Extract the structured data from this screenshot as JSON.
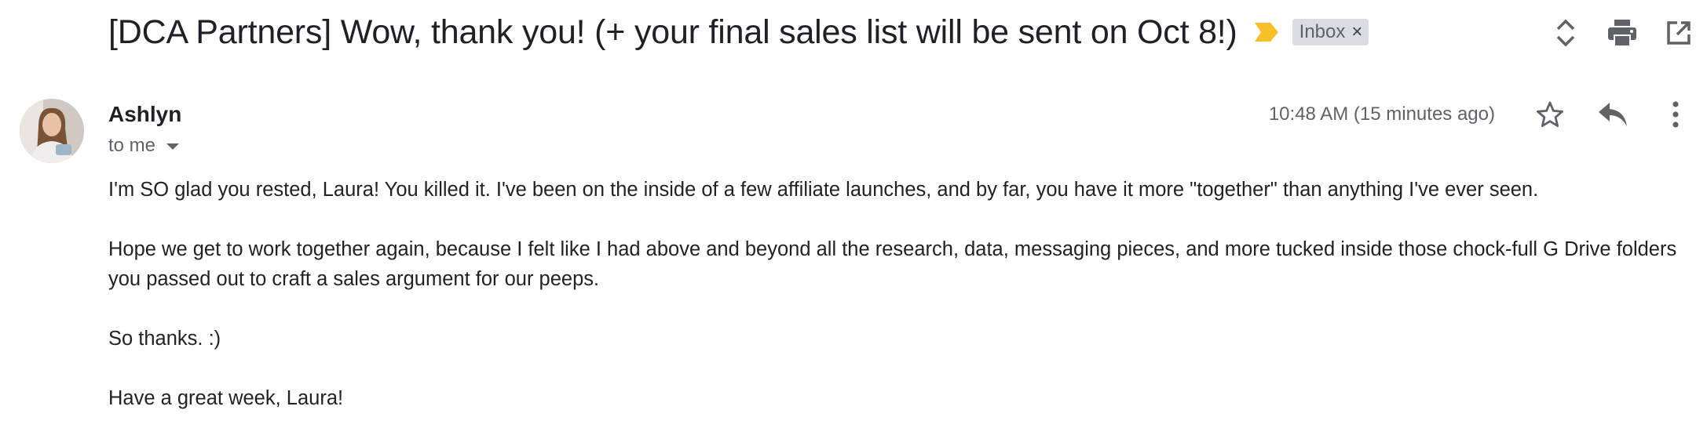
{
  "email": {
    "subject": "[DCA Partners] Wow, thank you! (+ your final sales list will be sent on Oct 8!)",
    "label": "Inbox",
    "label_remove": "×",
    "importance_color": "#f6c026",
    "sender": "Ashlyn",
    "recipient": "to me",
    "timestamp": "10:48 AM (15 minutes ago)",
    "body": [
      "I'm SO glad you rested, Laura! You killed it. I've been on the inside of a few affiliate launches, and by far, you have it more \"together\" than anything I've ever seen.",
      "Hope we get to work together again, because I felt like I had above and beyond all the research, data, messaging pieces, and more tucked inside those chock-full G Drive folders you passed out to craft a sales argument for our peeps.",
      "So thanks. :)",
      "Have a great week, Laura!"
    ]
  },
  "icons": {
    "expand": "unfold-icon",
    "print": "print-icon",
    "popout": "open-in-new-window-icon",
    "star": "star-outline-icon",
    "reply": "reply-icon",
    "more": "more-vertical-icon",
    "importance": "importance-marker-icon",
    "caret": "caret-down-icon"
  },
  "colors": {
    "text": "#202124",
    "secondary": "#5f6368",
    "chip_bg": "#dadce0"
  }
}
